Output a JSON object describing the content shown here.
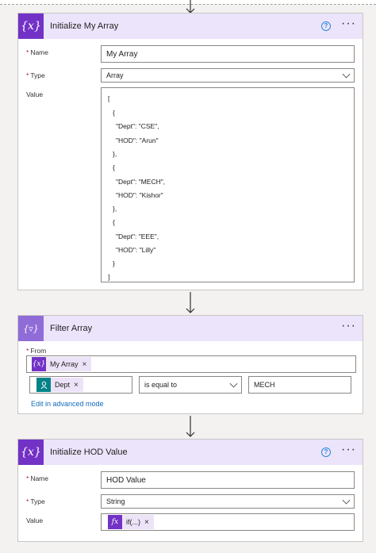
{
  "cards": {
    "init_array": {
      "title": "Initialize My Array",
      "icon": "{x}",
      "name_label": "Name",
      "name_value": "My Array",
      "type_label": "Type",
      "type_value": "Array",
      "value_label": "Value",
      "value_lines": [
        "[",
        "{",
        "\"Dept\": \"CSE\",",
        "\"HOD\": \"Arun\"",
        "},",
        "{",
        "\"Dept\": \"MECH\",",
        "\"HOD\": \"Kishor\"",
        "},",
        "{",
        "\"Dept\": \"EEE\",",
        "\"HOD\": \"Lilly\"",
        "}",
        "]"
      ]
    },
    "filter_array": {
      "title": "Filter Array",
      "icon": "{▿}",
      "from_label": "From",
      "from_token": "My Array",
      "from_token_icon": "{x}",
      "condition_left_token": "Dept",
      "condition_operator": "is equal to",
      "condition_right": "MECH",
      "advanced_link": "Edit in advanced mode"
    },
    "init_hod": {
      "title": "Initialize HOD Value",
      "icon": "{x}",
      "name_label": "Name",
      "name_value": "HOD Value",
      "type_label": "Type",
      "type_value": "String",
      "value_label": "Value",
      "value_token": "if(...)",
      "value_token_icon": "fx"
    }
  },
  "common": {
    "required_mark": "*",
    "help_glyph": "?",
    "more_glyph": "···",
    "token_close": "×"
  },
  "colors": {
    "header_bg": "#ece4fb",
    "variable_icon": "#7232c6",
    "teal_token": "#038387",
    "link": "#0f6cbd"
  }
}
